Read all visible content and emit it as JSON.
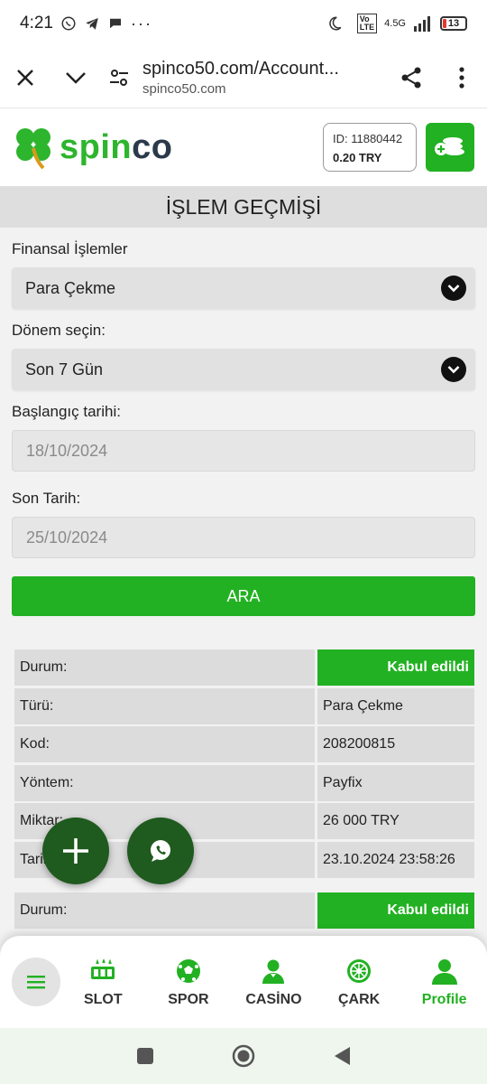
{
  "status": {
    "time": "4:21",
    "network": "4.5G",
    "battery": "13"
  },
  "browser": {
    "url": "spinco50.com/Account...",
    "domain": "spinco50.com"
  },
  "header": {
    "logo": "spinco",
    "user_id": "ID: 11880442",
    "balance": "0.20 TRY"
  },
  "page": {
    "title": "İŞLEM GEÇMİŞİ"
  },
  "form": {
    "financial_label": "Finansal İşlemler",
    "financial_value": "Para Çekme",
    "period_label": "Dönem seçin:",
    "period_value": "Son 7 Gün",
    "start_label": "Başlangıç tarihi:",
    "start_value": "18/10/2024",
    "end_label": "Son Tarih:",
    "end_value": "25/10/2024",
    "search_label": "ARA"
  },
  "records": [
    {
      "rows": [
        {
          "k": "Durum:",
          "v": "Kabul edildi"
        },
        {
          "k": "Türü:",
          "v": "Para Çekme"
        },
        {
          "k": "Kod:",
          "v": "208200815"
        },
        {
          "k": "Yöntem:",
          "v": "Payfix"
        },
        {
          "k": "Miktar:",
          "v": "26 000 TRY"
        },
        {
          "k": "Tarih:",
          "v": "23.10.2024 23:58:26"
        }
      ]
    },
    {
      "rows": [
        {
          "k": "Durum:",
          "v": "Kabul edildi"
        }
      ]
    }
  ],
  "nav": {
    "items": [
      {
        "label": "SLOT"
      },
      {
        "label": "SPOR"
      },
      {
        "label": "CASİNO"
      },
      {
        "label": "ÇARK"
      },
      {
        "label": "Profile"
      }
    ]
  },
  "colors": {
    "brand_green": "#22b122",
    "fab_dark_green": "#1f5a1f",
    "logo_dark": "#2b3a4a"
  }
}
